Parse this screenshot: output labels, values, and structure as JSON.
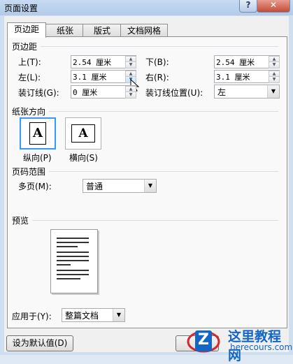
{
  "window": {
    "title": "页面设置",
    "help_glyph": "?",
    "close_glyph": "✕"
  },
  "tabs": [
    {
      "label": "页边距",
      "active": true
    },
    {
      "label": "纸张",
      "active": false
    },
    {
      "label": "版式",
      "active": false
    },
    {
      "label": "文档网格",
      "active": false
    }
  ],
  "margins": {
    "heading": "页边距",
    "top": {
      "label": "上(T):",
      "value": "2.54 厘米"
    },
    "bottom": {
      "label": "下(B):",
      "value": "2.54 厘米"
    },
    "left": {
      "label": "左(L):",
      "value": "3.1 厘米"
    },
    "right": {
      "label": "右(R):",
      "value": "3.1 厘米"
    },
    "gutter": {
      "label": "装订线(G):",
      "value": "0 厘米"
    },
    "gutter_position": {
      "label": "装订线位置(U):",
      "value": "左"
    }
  },
  "orientation": {
    "heading": "纸张方向",
    "portrait": {
      "label": "纵向(P)",
      "glyph": "A",
      "selected": true
    },
    "landscape": {
      "label": "横向(S)",
      "glyph": "A",
      "selected": false
    }
  },
  "pages": {
    "heading": "页码范围",
    "multiple_label": "多页(M):",
    "multiple_value": "普通"
  },
  "preview": {
    "heading": "预览"
  },
  "apply": {
    "label": "应用于(Y):",
    "value": "整篇文档"
  },
  "buttons": {
    "default_label": "设为默认值(D)"
  },
  "watermark": {
    "name": "这里教程网",
    "url": "herecours.com",
    "logo_glyph": "Z"
  },
  "colors": {
    "accent": "#3399ff",
    "watermark": "#1466c6"
  }
}
